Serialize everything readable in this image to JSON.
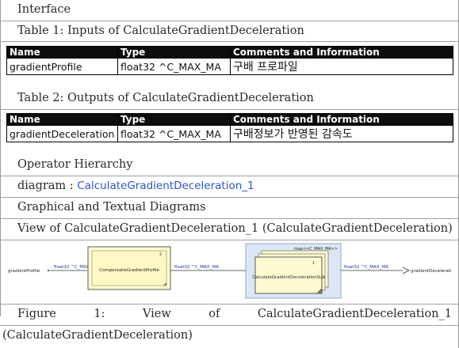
{
  "section_title": "Interface",
  "table1": {
    "caption": "Table 1: Inputs of CalculateGradientDeceleration",
    "headers": [
      "Name",
      "Type",
      "Comments and Information"
    ],
    "rows": [
      [
        "gradientProfile",
        "float32 ^C_MAX_MA",
        "구배 프로파일"
      ]
    ]
  },
  "table2": {
    "caption": "Table 2: Outputs of CalculateGradientDeceleration",
    "headers": [
      "Name",
      "Type",
      "Comments and Information"
    ],
    "rows": [
      [
        "gradientDeceleration",
        "float32 ^C_MAX_MA",
        "구배정보가 반영된 감속도"
      ]
    ]
  },
  "operator_hierarchy": "Operator Hierarchy",
  "diagram_label": "diagram :",
  "diagram_link": "CalculateGradientDeceleration_1",
  "graphical_heading": "Graphical and Textual Diagrams",
  "view_heading": "View of CalculateGradientDeceleration_1 (CalculateGradientDeceleration)",
  "diagram": {
    "input_name": "gradientProfile",
    "input_type": "float32 ^C_MAX_MA",
    "block1_index": "2",
    "block1_name": "CompensateGradientProfile",
    "mid_type": "float32 ^C_MAX_MA",
    "map_label": "map<<C_MAX_MA>>",
    "block2_index": "1",
    "block2_name": "CalculateGradientDecelerationSub",
    "out_type": "float32 ^C_MAX_MA",
    "output_name": "gradientDecelerati"
  },
  "figure_caption": {
    "line1": [
      "Figure",
      "1:",
      "View",
      "of",
      "CalculateGradientDeceleration_1"
    ],
    "line2": "(CalculateGradientDeceleration)"
  }
}
